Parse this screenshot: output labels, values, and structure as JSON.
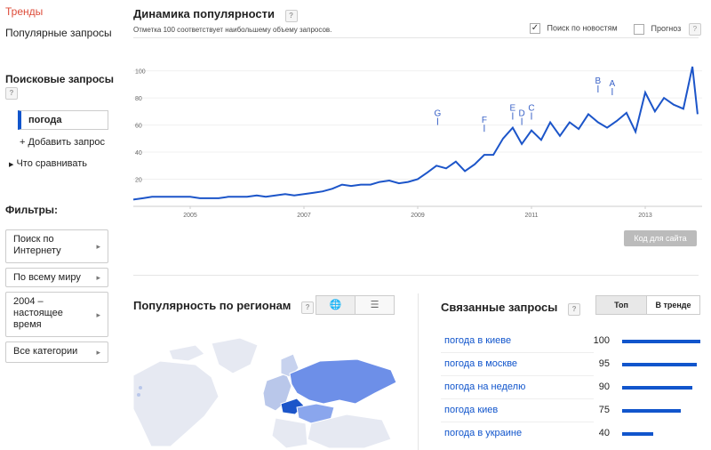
{
  "sidebar": {
    "trends": "Тренды",
    "popular": "Популярные запросы",
    "search_queries_title": "Поисковые запросы",
    "query": "погода",
    "add_query": "+ Добавить запрос",
    "compare": "Что сравнивать",
    "filters_title": "Фильтры:",
    "filters": [
      {
        "label": "Поиск по Интернету"
      },
      {
        "label": "По всему миру"
      },
      {
        "label": "2004 – настоящее время"
      },
      {
        "label": "Все категории"
      }
    ]
  },
  "main": {
    "title": "Динамика популярности",
    "subtitle": "Отметка 100 соответствует наибольшему объему запросов.",
    "news_check": "Поиск по новостям",
    "news_checked": true,
    "forecast_check": "Прогноз",
    "forecast_checked": false,
    "embed_button": "Код для сайта"
  },
  "chart_data": {
    "type": "line",
    "x_ticks": [
      "2005",
      "2007",
      "2009",
      "2011",
      "2013"
    ],
    "y_ticks": [
      "20",
      "40",
      "60",
      "80",
      "100"
    ],
    "ylim": [
      0,
      105
    ],
    "series": [
      {
        "color": "#1c55c9",
        "points": [
          [
            2004.0,
            5
          ],
          [
            2004.17,
            6
          ],
          [
            2004.33,
            7
          ],
          [
            2004.5,
            7
          ],
          [
            2004.67,
            7
          ],
          [
            2004.83,
            7
          ],
          [
            2005.0,
            7
          ],
          [
            2005.17,
            6
          ],
          [
            2005.33,
            6
          ],
          [
            2005.5,
            6
          ],
          [
            2005.67,
            7
          ],
          [
            2005.83,
            7
          ],
          [
            2006.0,
            7
          ],
          [
            2006.17,
            8
          ],
          [
            2006.33,
            7
          ],
          [
            2006.5,
            8
          ],
          [
            2006.67,
            9
          ],
          [
            2006.83,
            8
          ],
          [
            2007.0,
            9
          ],
          [
            2007.17,
            10
          ],
          [
            2007.33,
            11
          ],
          [
            2007.5,
            13
          ],
          [
            2007.67,
            16
          ],
          [
            2007.83,
            15
          ],
          [
            2008.0,
            16
          ],
          [
            2008.17,
            16
          ],
          [
            2008.33,
            18
          ],
          [
            2008.5,
            19
          ],
          [
            2008.67,
            17
          ],
          [
            2008.83,
            18
          ],
          [
            2009.0,
            20
          ],
          [
            2009.17,
            25
          ],
          [
            2009.33,
            30
          ],
          [
            2009.5,
            28
          ],
          [
            2009.67,
            33
          ],
          [
            2009.83,
            26
          ],
          [
            2010.0,
            31
          ],
          [
            2010.17,
            38
          ],
          [
            2010.33,
            38
          ],
          [
            2010.5,
            50
          ],
          [
            2010.67,
            58
          ],
          [
            2010.83,
            46
          ],
          [
            2011.0,
            56
          ],
          [
            2011.17,
            49
          ],
          [
            2011.33,
            62
          ],
          [
            2011.5,
            52
          ],
          [
            2011.67,
            62
          ],
          [
            2011.83,
            57
          ],
          [
            2012.0,
            68
          ],
          [
            2012.17,
            62
          ],
          [
            2012.33,
            58
          ],
          [
            2012.5,
            63
          ],
          [
            2012.67,
            69
          ],
          [
            2012.83,
            55
          ],
          [
            2013.0,
            84
          ],
          [
            2013.17,
            70
          ],
          [
            2013.33,
            80
          ],
          [
            2013.5,
            75
          ],
          [
            2013.67,
            72
          ],
          [
            2013.83,
            103
          ],
          [
            2013.92,
            68
          ]
        ]
      }
    ],
    "annotations": [
      {
        "letter": "G",
        "x": 2009.35,
        "y": 60
      },
      {
        "letter": "F",
        "x": 2010.17,
        "y": 55
      },
      {
        "letter": "E",
        "x": 2010.67,
        "y": 64
      },
      {
        "letter": "D",
        "x": 2010.83,
        "y": 60
      },
      {
        "letter": "C",
        "x": 2011.0,
        "y": 64
      },
      {
        "letter": "B",
        "x": 2012.17,
        "y": 84
      },
      {
        "letter": "A",
        "x": 2012.42,
        "y": 82
      }
    ]
  },
  "regions": {
    "title": "Популярность по регионам",
    "map_icon": "globe-icon",
    "list_icon": "list-icon"
  },
  "related": {
    "title": "Связанные запросы",
    "tab_top": "Топ",
    "tab_rising": "В тренде",
    "rows": [
      {
        "label": "погода в киеве",
        "value": "100",
        "pct": 100
      },
      {
        "label": "погода в москве",
        "value": "95",
        "pct": 95
      },
      {
        "label": "погода на неделю",
        "value": "90",
        "pct": 90
      },
      {
        "label": "погода киев",
        "value": "75",
        "pct": 75
      },
      {
        "label": "погода в украине",
        "value": "40",
        "pct": 40
      }
    ]
  }
}
